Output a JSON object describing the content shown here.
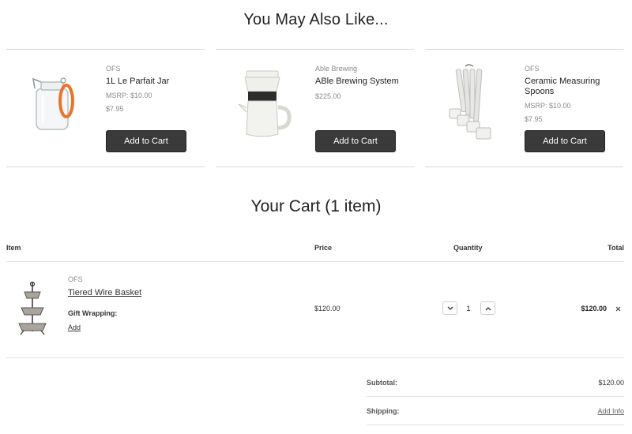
{
  "recommendations": {
    "title": "You May Also Like...",
    "products": [
      {
        "brand": "OFS",
        "name": "1L Le Parfait Jar",
        "msrp": "MSRP: $10.00",
        "price": "$7.95",
        "button": "Add to Cart",
        "icon": "glass-jar-icon"
      },
      {
        "brand": "Able Brewing",
        "name": "ABle Brewing System",
        "msrp": "",
        "price": "$225.00",
        "button": "Add to Cart",
        "icon": "pour-over-coffee-icon"
      },
      {
        "brand": "OFS",
        "name": "Ceramic Measuring Spoons",
        "msrp": "MSRP: $10.00",
        "price": "$7.95",
        "button": "Add to Cart",
        "icon": "measuring-spoons-icon"
      }
    ]
  },
  "cart": {
    "title": "Your Cart (1 item)",
    "headers": {
      "item": "Item",
      "price": "Price",
      "quantity": "Quantity",
      "total": "Total"
    },
    "items": [
      {
        "brand": "OFS",
        "name": "Tiered Wire Basket",
        "gift_label": "Gift Wrapping:",
        "gift_action": "Add",
        "price": "$120.00",
        "quantity": "1",
        "total": "$120.00",
        "icon": "tiered-basket-icon"
      }
    ],
    "summary": {
      "subtotal_label": "Subtotal:",
      "subtotal_value": "$120.00",
      "shipping_label": "Shipping:",
      "shipping_action": "Add Info"
    }
  },
  "colors": {
    "button_bg": "#3a3a3a",
    "divider": "#d8d8d8",
    "accent_orange": "#e8742a"
  }
}
